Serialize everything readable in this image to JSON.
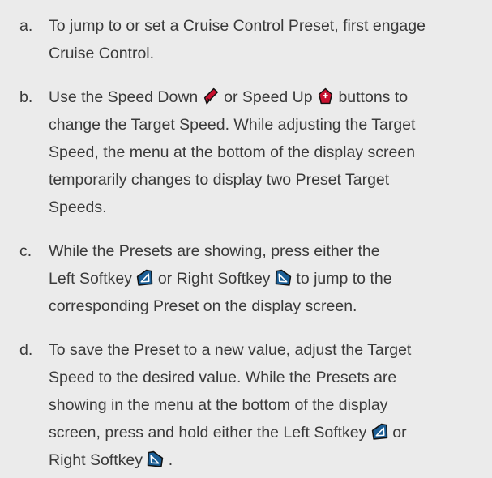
{
  "colors": {
    "background": "#ebebeb",
    "text": "#3a3a3a",
    "speed_button_fill": "#c8102e",
    "softkey_fill": "#1b5e95",
    "icon_outline": "#111111"
  },
  "icons": {
    "speed_down": "speed-down-button",
    "speed_up": "speed-up-button",
    "left_softkey": "left-softkey",
    "right_softkey": "right-softkey"
  },
  "steps": [
    {
      "marker": "a.",
      "line1": "To jump to or set a Cruise Control Preset, first engage",
      "line2": "Cruise Control."
    },
    {
      "marker": "b.",
      "line1_a": "Use the Speed Down ",
      "line1_b": " or Speed Up ",
      "line1_c": " buttons to",
      "line2": "change the Target Speed. While adjusting the Target",
      "line3": "Speed, the menu at the bottom of the display screen",
      "line4": "temporarily changes to display two Preset Target",
      "line5": "Speeds."
    },
    {
      "marker": "c.",
      "line1": "While the Presets are showing, press either the",
      "line2_a": "Left Softkey ",
      "line2_b": " or Right Softkey ",
      "line2_c": " to jump to the",
      "line3": "corresponding Preset on the display screen."
    },
    {
      "marker": "d.",
      "line1": "To save the Preset to a new value, adjust the Target",
      "line2": "Speed to the desired value. While the Presets are",
      "line3": "showing in the menu at the bottom of the display",
      "line4_a": "screen, press and hold either the Left Softkey ",
      "line4_b": " or",
      "line5_a": "Right Softkey ",
      "line5_b": " ."
    }
  ]
}
